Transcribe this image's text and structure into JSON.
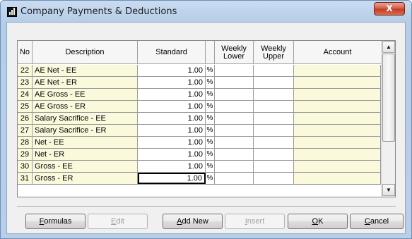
{
  "window": {
    "title": "Company Payments & Deductions",
    "close_glyph": "X"
  },
  "columns": {
    "no": "No",
    "description": "Description",
    "standard": "Standard",
    "weekly_lower": [
      "Weekly",
      "Lower"
    ],
    "weekly_upper": [
      "Weekly",
      "Upper"
    ],
    "account": "Account"
  },
  "percent_symbol": "%",
  "rows": [
    {
      "no": "22",
      "description": "AE Net - EE",
      "standard": "1.00"
    },
    {
      "no": "23",
      "description": "AE Net - ER",
      "standard": "1.00"
    },
    {
      "no": "24",
      "description": "AE Gross - EE",
      "standard": "1.00"
    },
    {
      "no": "25",
      "description": "AE Gross - ER",
      "standard": "1.00"
    },
    {
      "no": "26",
      "description": "Salary Sacrifice - EE",
      "standard": "1.00"
    },
    {
      "no": "27",
      "description": "Salary Sacrifice - ER",
      "standard": "1.00"
    },
    {
      "no": "28",
      "description": "Net - EE",
      "standard": "1.00"
    },
    {
      "no": "29",
      "description": "Net - ER",
      "standard": "1.00"
    },
    {
      "no": "30",
      "description": "Gross - EE",
      "standard": "1.00"
    },
    {
      "no": "31",
      "description": "Gross - ER",
      "standard": "1.00"
    }
  ],
  "buttons": {
    "formulas": {
      "accel": "F",
      "rest": "ormulas"
    },
    "edit": {
      "accel": "E",
      "rest": "dit"
    },
    "add_new": {
      "accel": "A",
      "rest": "dd New"
    },
    "insert": {
      "accel": "I",
      "rest": "nsert"
    },
    "ok": {
      "accel": "O",
      "rest": "K"
    },
    "cancel": {
      "accel": "C",
      "rest": "ancel"
    }
  },
  "icons": {
    "scroll_up": "▲",
    "scroll_down": "▼"
  }
}
